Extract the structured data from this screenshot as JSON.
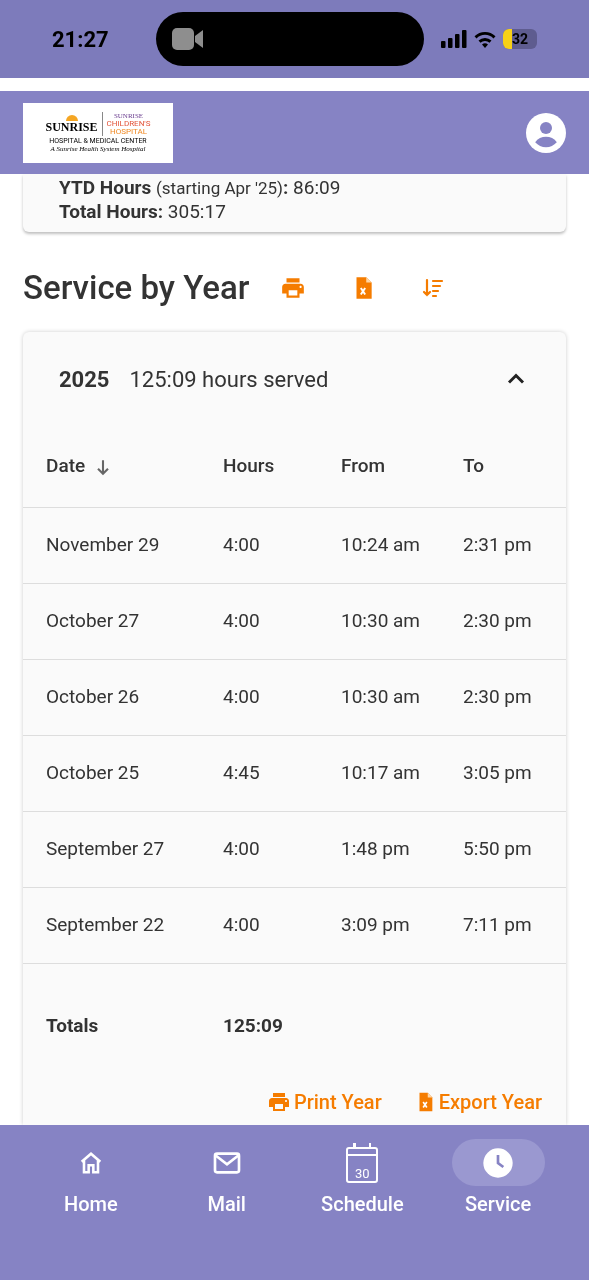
{
  "status_bar": {
    "time": "21:27",
    "battery": "32"
  },
  "header": {
    "logo": {
      "left_name": "SUNRISE",
      "left_sub": "HOSPITAL & MEDICAL CENTER",
      "right_brand": "SUNRISE",
      "right_line1": "CHILDREN'S",
      "right_line2": "HOSPITAL",
      "tagline": "A Sunrise Health System Hospital"
    }
  },
  "summary": {
    "ytd_label": "YTD Hours",
    "ytd_note": "(starting Apr '25)",
    "ytd_colon": ":",
    "ytd_value": "86:09",
    "total_label": "Total Hours:",
    "total_value": "305:17"
  },
  "section": {
    "title": "Service by Year"
  },
  "year_panel": {
    "year": "2025",
    "summary": "125:09 hours served",
    "expanded": true,
    "columns": [
      {
        "label": "Date",
        "sorted": true
      },
      {
        "label": "Hours",
        "sorted": false
      },
      {
        "label": "From",
        "sorted": false
      },
      {
        "label": "To",
        "sorted": false
      }
    ],
    "rows": [
      [
        "November 29",
        "4:00",
        "10:24 am",
        "2:31 pm"
      ],
      [
        "October 27",
        "4:00",
        "10:30 am",
        "2:30 pm"
      ],
      [
        "October 26",
        "4:00",
        "10:30 am",
        "2:30 pm"
      ],
      [
        "October 25",
        "4:45",
        "10:17 am",
        "3:05 pm"
      ],
      [
        "September 27",
        "4:00",
        "1:48 pm",
        "5:50 pm"
      ],
      [
        "September 22",
        "4:00",
        "3:09 pm",
        "7:11 pm"
      ]
    ],
    "totals": {
      "label": "Totals",
      "hours": "125:09"
    },
    "actions": [
      {
        "kind": "print",
        "label": "Print Year"
      },
      {
        "kind": "export",
        "label": "Export Year"
      }
    ]
  },
  "bottom_nav": [
    {
      "kind": "home",
      "label": "Home",
      "selected": false
    },
    {
      "kind": "mail",
      "label": "Mail",
      "selected": false
    },
    {
      "kind": "schedule",
      "label": "Schedule",
      "selected": false,
      "badge": "30"
    },
    {
      "kind": "service",
      "label": "Service",
      "selected": true
    }
  ]
}
